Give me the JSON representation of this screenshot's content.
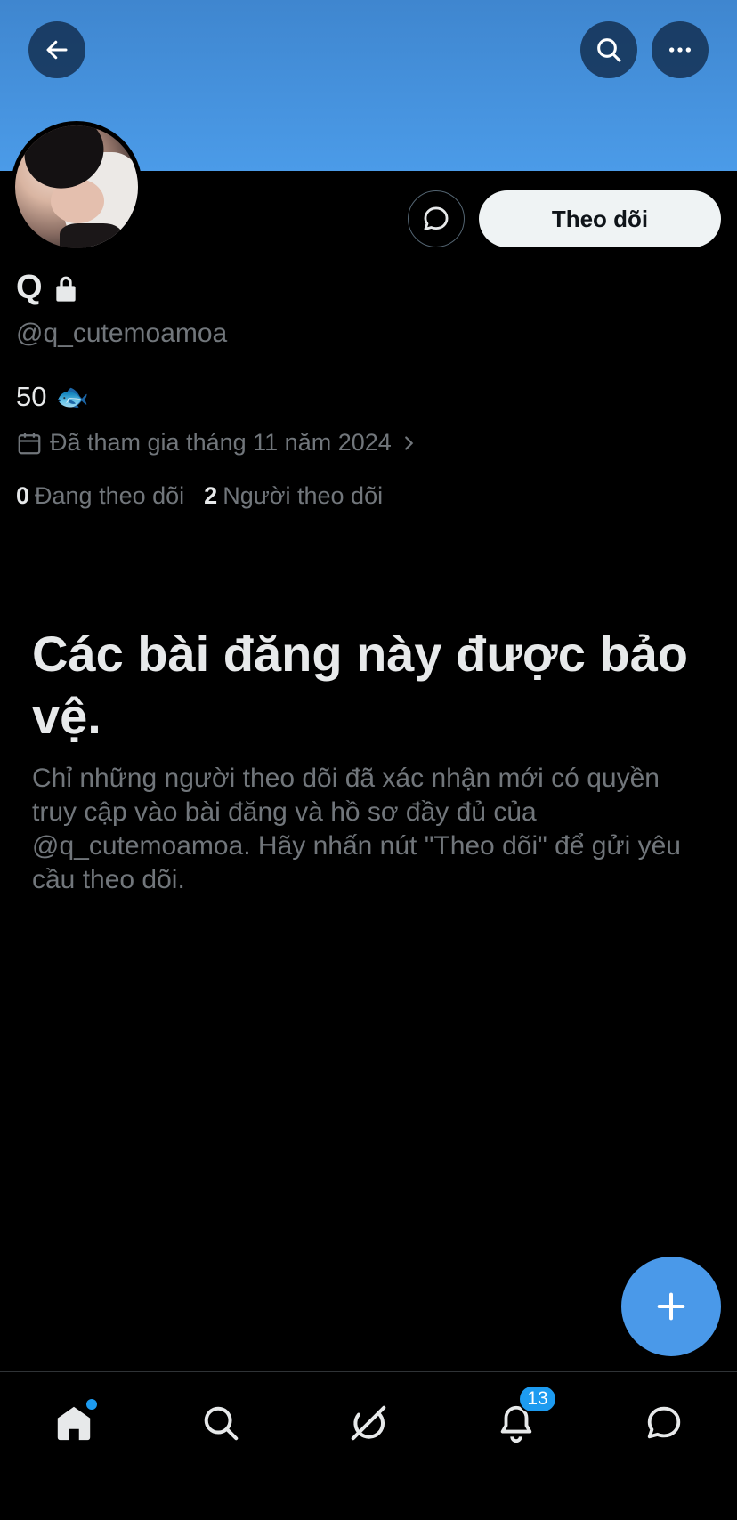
{
  "profile": {
    "display_name": "Q",
    "handle": "@q_cutemoamoa",
    "bio_text": "50",
    "bio_emoji": "🐟",
    "joined": "Đã tham gia tháng 11 năm 2024",
    "following_count": "0",
    "following_label": "Đang theo dõi",
    "followers_count": "2",
    "followers_label": "Người theo dõi"
  },
  "actions": {
    "follow_label": "Theo dõi"
  },
  "protected": {
    "title": "Các bài đăng này được bảo vệ.",
    "description": "Chỉ những người theo dõi đã xác nhận mới có quyền truy cập vào bài đăng và hồ sơ đầy đủ của @q_cutemoamoa. Hãy nhấn nút \"Theo dõi\" để gửi yêu cầu theo dõi."
  },
  "nav": {
    "notifications_badge": "13",
    "items": [
      "home-icon",
      "search-icon",
      "grok-icon",
      "bell-icon",
      "chat-icon"
    ]
  },
  "colors": {
    "banner": "#4b9be8",
    "accent": "#1d9bf0",
    "fab": "#4a99e9",
    "follow_button_bg": "#eff3f4"
  }
}
